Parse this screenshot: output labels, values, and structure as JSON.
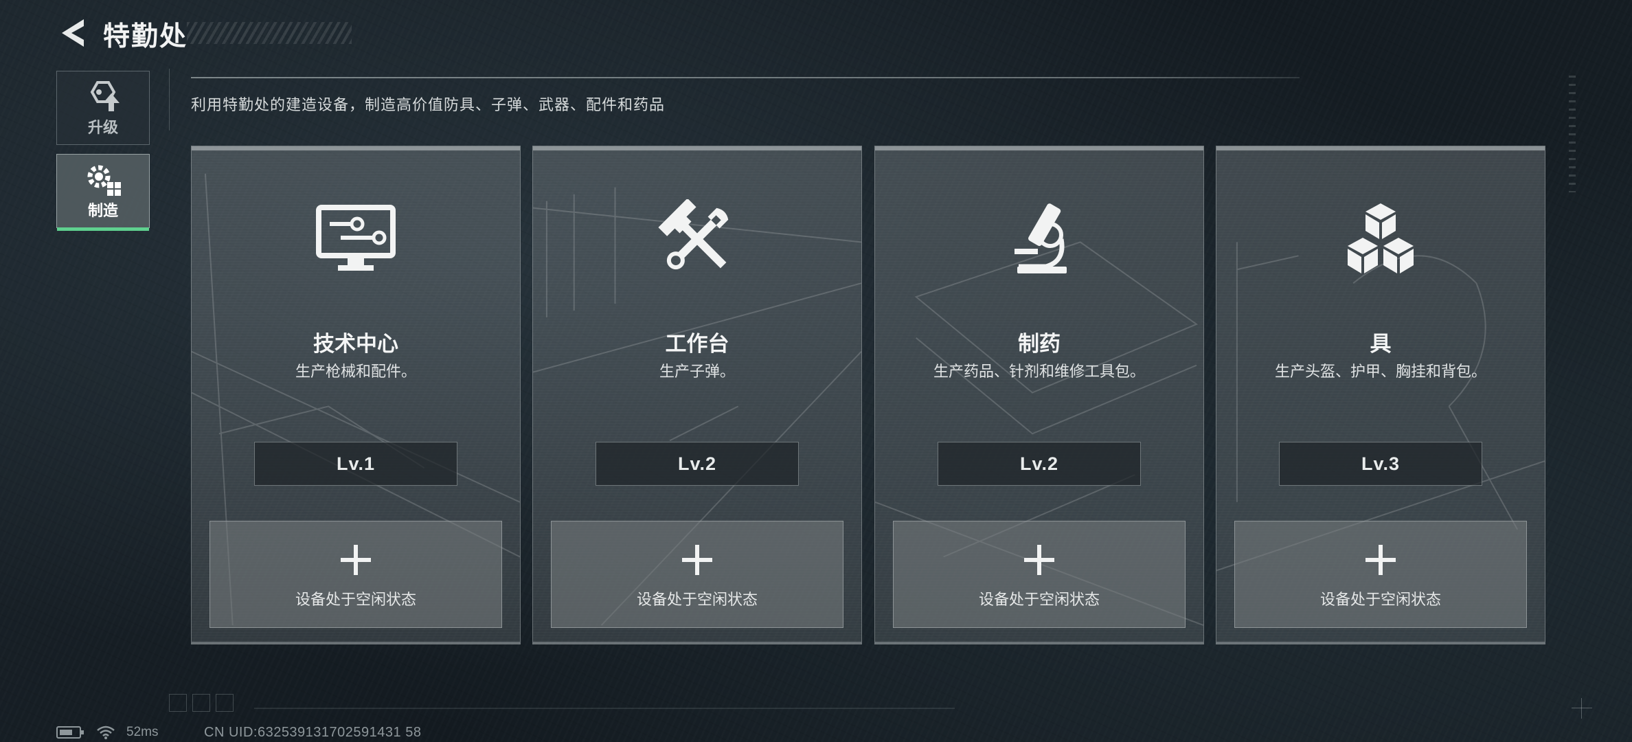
{
  "header": {
    "title": "特勤处"
  },
  "nav": {
    "upgrade_label": "升级",
    "craft_label": "制造"
  },
  "subtitle": "利用特勤处的建造设备，制造高价值防具、子弹、武器、配件和药品",
  "cards": [
    {
      "title": "技术中心",
      "desc": "生产枪械和配件。",
      "level": "Lv.1",
      "slot_status": "设备处于空闲状态",
      "icon": "monitor-icon"
    },
    {
      "title": "工作台",
      "desc": "生产子弹。",
      "level": "Lv.2",
      "slot_status": "设备处于空闲状态",
      "icon": "hammer-wrench-icon"
    },
    {
      "title": "制药",
      "desc": "生产药品、针剂和维修工具包。",
      "level": "Lv.2",
      "slot_status": "设备处于空闲状态",
      "icon": "microscope-icon"
    },
    {
      "title": "具",
      "desc": "生产头盔、护甲、胸挂和背包。",
      "level": "Lv.3",
      "slot_status": "设备处于空闲状态",
      "icon": "cubes-icon"
    }
  ],
  "status": {
    "ping": "52ms",
    "uid": "CN UID:632539131702591431 58"
  },
  "colors": {
    "accent_green": "#5fd08f",
    "background": "#1a2329"
  }
}
